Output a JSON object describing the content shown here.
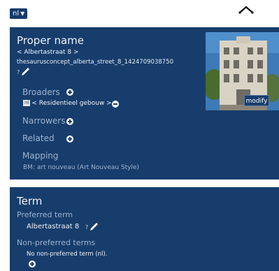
{
  "language_selector": {
    "label": "nl"
  },
  "concept": {
    "proper_name_heading": "Proper name",
    "uri_line": "< Albertastraat 8 >",
    "concept_id": "thesaurusconcept_alberta_street_8_1424709038750",
    "broaders_label": "Broaders",
    "broader_lang": "nl",
    "broader_value": "< Residentieel gebouw >",
    "narrowers_label": "Narrowers",
    "related_label": "Related",
    "mapping_label": "Mapping",
    "mapping_value": "BM: art nouveau  (Art Nouveau Style)",
    "image_button": "modify"
  },
  "term": {
    "heading": "Term",
    "preferred_label": "Preferred term",
    "preferred_value": "Albertastraat 8",
    "nonpreferred_label": "Non-preferred terms",
    "nonpreferred_value": "No non-preferred term (nl)."
  },
  "icons": [
    "chevron-up-icon",
    "edit-pencil-icon",
    "add-circle-icon",
    "remove-circle-icon"
  ],
  "colors": {
    "panel": "#173d6c",
    "label": "#9fb3cf",
    "text": "#eef2f8"
  }
}
